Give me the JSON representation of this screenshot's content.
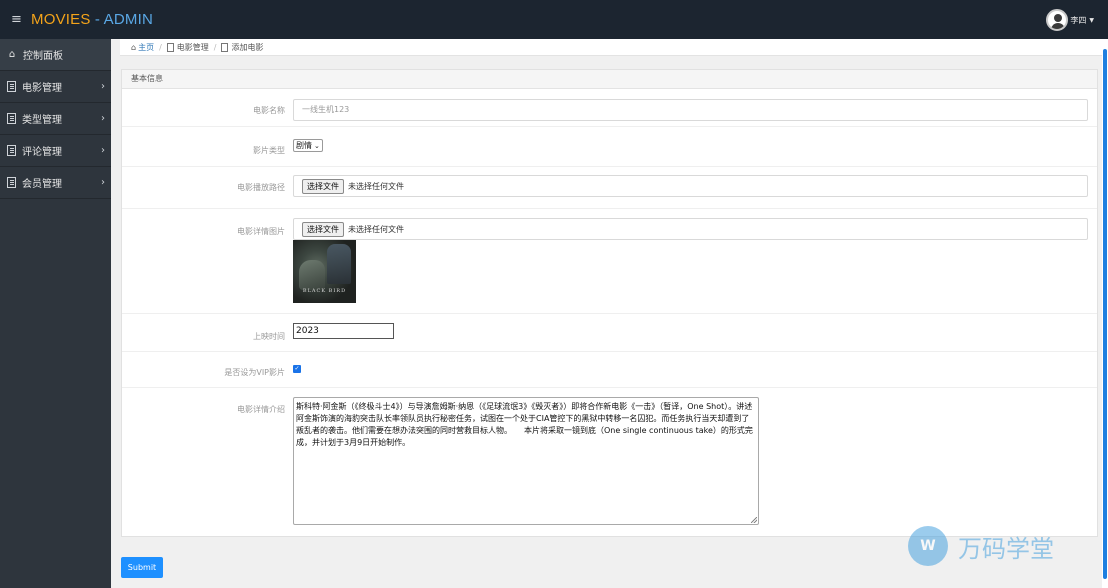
{
  "header": {
    "brand_part1": "MOVIES",
    "brand_part2": " - ADMIN",
    "user_name": "李四"
  },
  "sidebar": {
    "items": [
      {
        "label": "控制面板"
      },
      {
        "label": "电影管理"
      },
      {
        "label": "类型管理"
      },
      {
        "label": "评论管理"
      },
      {
        "label": "会员管理"
      }
    ]
  },
  "breadcrumb": {
    "home": "主页",
    "section": "电影管理",
    "current": "添加电影"
  },
  "form": {
    "panel_title": "基本信息",
    "name_label": "电影名称",
    "name_value": "一线生机123",
    "type_label": "影片类型",
    "type_value": "剧情",
    "video_label": "电影播放路径",
    "file_button": "选择文件",
    "no_file_text": "未选择任何文件",
    "image_label": "电影详情图片",
    "poster_title": "BLACK BIRD",
    "date_label": "上映时间",
    "date_value": "2023",
    "vip_label": "是否设为VIP影片",
    "vip_checked": true,
    "intro_label": "电影详情介绍",
    "intro_value": "斯科特·阿金斯（《终极斗士4》）与导演詹姆斯·纳恩（《足球流氓3》《毁灭者》）即将合作新电影《一击》（暂译，One Shot）。讲述阿金斯饰演的海豹突击队长率领队员执行秘密任务，试图在一个处于CIA管控下的黑狱中转移一名囚犯。而任务执行当天却遭到了叛乱者的袭击。他们需要在想办法突围的同时营救目标人物。　　本片将采取一镜到底（One single continuous take）的形式完成，并计划于3月9日开始制作。",
    "submit_label": "Submit"
  },
  "watermark": {
    "logo_text": "W",
    "text": "万码学堂"
  },
  "colors": {
    "topbar": "#1c2530",
    "sidebar": "#2e353d",
    "brand_orange": "#f4a41a",
    "brand_blue": "#5aa8e6",
    "submit_blue": "#1e90ff"
  }
}
